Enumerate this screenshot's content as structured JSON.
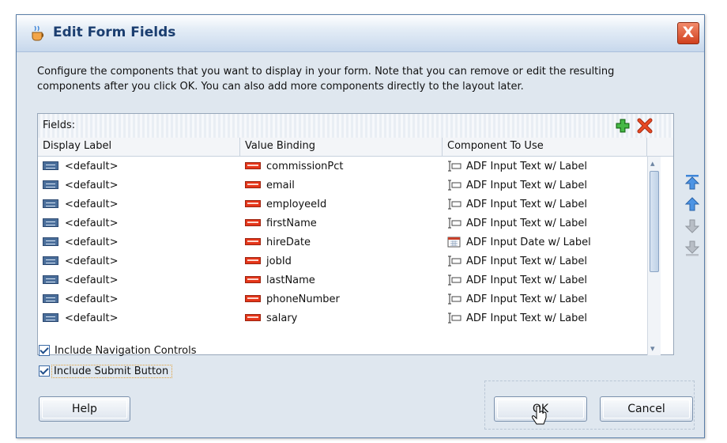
{
  "dialog": {
    "title": "Edit Form Fields",
    "close_label": "X"
  },
  "description": {
    "line1": "Configure the components that you want to display in your form.  Note that you can remove or edit the resulting",
    "line2": "components after you click OK.  You can also add more components directly to the layout later."
  },
  "fields": {
    "label": "Fields:",
    "columns": [
      "Display Label",
      "Value Binding",
      "Component To Use"
    ],
    "rows": [
      {
        "label": "<default>",
        "binding": "commissionPct",
        "component": "ADF Input Text w/ Label",
        "comp_icon": "input-text-icon"
      },
      {
        "label": "<default>",
        "binding": "email",
        "component": "ADF Input Text w/ Label",
        "comp_icon": "input-text-icon"
      },
      {
        "label": "<default>",
        "binding": "employeeId",
        "component": "ADF Input Text w/ Label",
        "comp_icon": "input-text-icon"
      },
      {
        "label": "<default>",
        "binding": "firstName",
        "component": "ADF Input Text w/ Label",
        "comp_icon": "input-text-icon"
      },
      {
        "label": "<default>",
        "binding": "hireDate",
        "component": "ADF Input Date w/ Label",
        "comp_icon": "input-date-icon"
      },
      {
        "label": "<default>",
        "binding": "jobId",
        "component": "ADF Input Text w/ Label",
        "comp_icon": "input-text-icon"
      },
      {
        "label": "<default>",
        "binding": "lastName",
        "component": "ADF Input Text w/ Label",
        "comp_icon": "input-text-icon"
      },
      {
        "label": "<default>",
        "binding": "phoneNumber",
        "component": "ADF Input Text w/ Label",
        "comp_icon": "input-text-icon"
      },
      {
        "label": "<default>",
        "binding": "salary",
        "component": "ADF Input Text w/ Label",
        "comp_icon": "input-text-icon"
      }
    ]
  },
  "options": {
    "nav_controls": "Include Navigation Controls",
    "submit_button": "Include Submit Button"
  },
  "buttons": {
    "help": "Help",
    "ok": "OK",
    "cancel": "Cancel"
  },
  "colors": {
    "title_text": "#1b3e70",
    "add_icon": "#2e9a2e",
    "delete_icon": "#d23a1a",
    "move_icon": "#3f86d8"
  }
}
